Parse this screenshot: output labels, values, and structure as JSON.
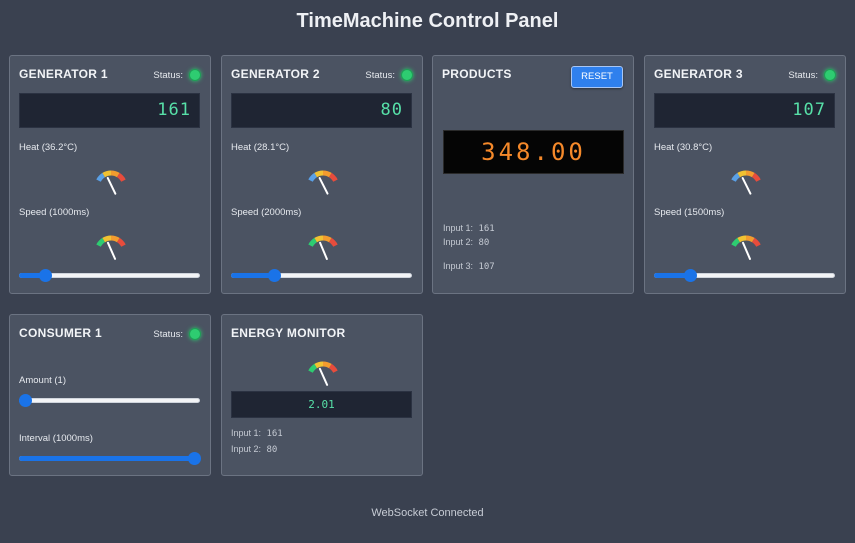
{
  "title": "TimeMachine Control Panel",
  "status_label": "Status:",
  "accent_color": "#2f80ed",
  "status_color": "#2ecc71",
  "generators": [
    {
      "title": "GENERATOR 1",
      "value": "161",
      "heat_label": "Heat (36.2°C)",
      "heat_level": 0.26,
      "speed_label": "Speed (1000ms)",
      "speed_level": 0.48,
      "slider_level": 0.12,
      "status": "online"
    },
    {
      "title": "GENERATOR 2",
      "value": "80",
      "heat_label": "Heat (28.1°C)",
      "heat_level": 0.15,
      "speed_label": "Speed (2000ms)",
      "speed_level": 0.6,
      "slider_level": 0.22,
      "status": "online"
    },
    {
      "title": "GENERATOR 3",
      "value": "107",
      "heat_label": "Heat (30.8°C)",
      "heat_level": 0.18,
      "speed_label": "Speed (1500ms)",
      "speed_level": 0.54,
      "slider_level": 0.18,
      "status": "online"
    }
  ],
  "products": {
    "title": "PRODUCTS",
    "reset_label": "RESET",
    "value": "348.00",
    "inputs": [
      {
        "label": "Input 1:",
        "value": "161"
      },
      {
        "label": "Input 2:",
        "value": "80"
      },
      {
        "label": "Input 3:",
        "value": "107"
      }
    ]
  },
  "consumer": {
    "title": "CONSUMER 1",
    "amount_label": "Amount (1)",
    "amount_level": 0.0,
    "interval_label": "Interval (1000ms)",
    "interval_level": 1.0,
    "status": "online"
  },
  "energy": {
    "title": "ENERGY MONITOR",
    "value": "2.01",
    "gauge_level": 0.45,
    "inputs": [
      {
        "label": "Input 1:",
        "value": "161"
      },
      {
        "label": "Input 2:",
        "value": "80"
      }
    ]
  },
  "footer": "WebSocket Connected"
}
